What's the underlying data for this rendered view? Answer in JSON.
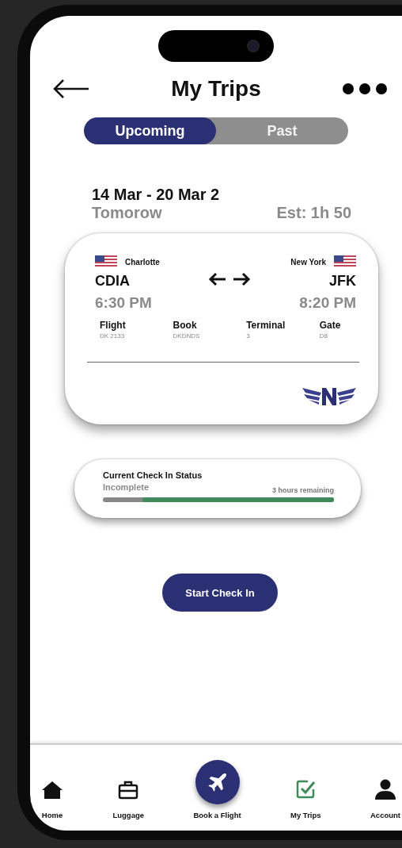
{
  "header": {
    "title": "My Trips"
  },
  "tabs": [
    {
      "label": "Upcoming",
      "selected": true
    },
    {
      "label": "Past",
      "selected": false
    }
  ],
  "trip": {
    "dates": "14 Mar - 20 Mar 2",
    "when": "Tomorow",
    "estimate": "Est: 1h 50"
  },
  "ticket": {
    "origin": {
      "city": "Charlotte",
      "code": "CDIA",
      "time": "6:30 PM"
    },
    "destination": {
      "city": "New York",
      "code": "JFK",
      "time": "8:20 PM"
    },
    "details": [
      {
        "label": "Flight",
        "value": "DK 2133"
      },
      {
        "label": "Book",
        "value": "DKDNDS"
      },
      {
        "label": "Terminal",
        "value": "3"
      },
      {
        "label": "Gate",
        "value": "D8"
      }
    ]
  },
  "status": {
    "title": "Current Check In Status",
    "state": "Incomplete",
    "remaining": "3 hours remaining",
    "level": 0.83
  },
  "action": {
    "label": "Start Check In"
  },
  "nav": [
    {
      "label": "Home",
      "kind": "home",
      "selected": false
    },
    {
      "label": "Luggage",
      "kind": "luggage",
      "selected": false
    },
    {
      "label": "Book a Flight",
      "kind": "fab",
      "selected": false
    },
    {
      "label": "My Trips",
      "kind": "trips",
      "selected": true
    },
    {
      "label": "Account",
      "kind": "account",
      "selected": false
    }
  ]
}
